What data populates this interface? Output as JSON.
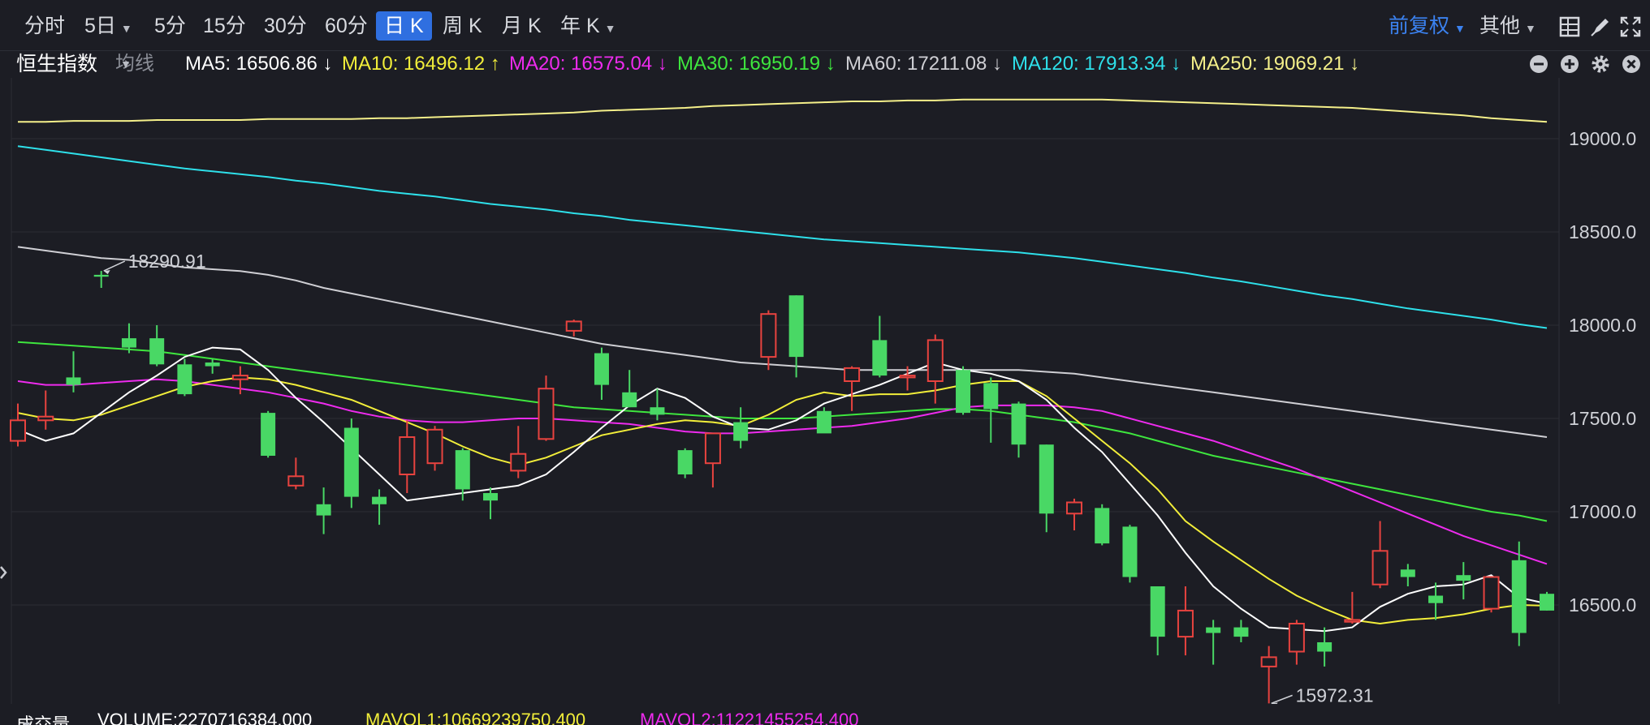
{
  "toolbar": {
    "timeframes": [
      {
        "label": "分时",
        "active": false,
        "dropdown": false
      },
      {
        "label": "5日",
        "active": false,
        "dropdown": true
      },
      {
        "label": "5分",
        "active": false,
        "dropdown": false
      },
      {
        "label": "15分",
        "active": false,
        "dropdown": false
      },
      {
        "label": "30分",
        "active": false,
        "dropdown": false
      },
      {
        "label": "60分",
        "active": false,
        "dropdown": false
      },
      {
        "label": "日 K",
        "active": true,
        "dropdown": false
      },
      {
        "label": "周 K",
        "active": false,
        "dropdown": false
      },
      {
        "label": "月 K",
        "active": false,
        "dropdown": false
      },
      {
        "label": "年 K",
        "active": false,
        "dropdown": true
      }
    ],
    "adjust_label": "前复权",
    "other_label": "其他",
    "icons": [
      "grid-layout-icon",
      "pen-draw-icon",
      "fullscreen-icon"
    ]
  },
  "indicator_bar": {
    "index_name": "恒生指数",
    "ma_selector": "均线",
    "mas": [
      {
        "label": "MA5: 16506.86",
        "arrow": "↓",
        "color": "#ffffff"
      },
      {
        "label": "MA10: 16496.12",
        "arrow": "↑",
        "color": "#f2ee3a"
      },
      {
        "label": "MA20: 16575.04",
        "arrow": "↓",
        "color": "#ee2bee"
      },
      {
        "label": "MA30: 16950.19",
        "arrow": "↓",
        "color": "#3ee63e"
      },
      {
        "label": "MA60: 17211.08",
        "arrow": "↓",
        "color": "#cfcfd4"
      },
      {
        "label": "MA120: 17913.34",
        "arrow": "↓",
        "color": "#2ee0ea"
      },
      {
        "label": "MA250: 19069.21",
        "arrow": "↓",
        "color": "#f5f08a"
      }
    ],
    "controls": [
      "minus-circle-icon",
      "plus-circle-icon",
      "gear-icon",
      "close-icon"
    ]
  },
  "chart_data": {
    "type": "candlestick",
    "ylim": [
      15980,
      19250
    ],
    "y_ticks": [
      19000.0,
      18500.0,
      18000.0,
      17500.0,
      17000.0,
      16500.0
    ],
    "y_tick_labels": [
      "19000.0",
      "18500.0",
      "18000.0",
      "17500.0",
      "17000.0",
      "16500.0"
    ],
    "up_color": "#e8433f",
    "down_color": "#49d865",
    "candles": [
      {
        "open": 17380,
        "high": 17580,
        "low": 17350,
        "close": 17490
      },
      {
        "open": 17490,
        "high": 17650,
        "low": 17440,
        "close": 17510
      },
      {
        "open": 17720,
        "high": 17860,
        "low": 17640,
        "close": 17680
      },
      {
        "open": 18270,
        "high": 18290.91,
        "low": 18200,
        "close": 18260
      },
      {
        "open": 17930,
        "high": 18010,
        "low": 17850,
        "close": 17880
      },
      {
        "open": 17930,
        "high": 18000,
        "low": 17780,
        "close": 17790
      },
      {
        "open": 17790,
        "high": 17820,
        "low": 17620,
        "close": 17630
      },
      {
        "open": 17800,
        "high": 17820,
        "low": 17740,
        "close": 17780
      },
      {
        "open": 17710,
        "high": 17780,
        "low": 17630,
        "close": 17730
      },
      {
        "open": 17530,
        "high": 17540,
        "low": 17290,
        "close": 17300
      },
      {
        "open": 17140,
        "high": 17290,
        "low": 17120,
        "close": 17190
      },
      {
        "open": 17040,
        "high": 17130,
        "low": 16880,
        "close": 16980
      },
      {
        "open": 17450,
        "high": 17500,
        "low": 17020,
        "close": 17080
      },
      {
        "open": 17080,
        "high": 17120,
        "low": 16930,
        "close": 17040
      },
      {
        "open": 17200,
        "high": 17490,
        "low": 17100,
        "close": 17400
      },
      {
        "open": 17260,
        "high": 17460,
        "low": 17220,
        "close": 17440
      },
      {
        "open": 17330,
        "high": 17340,
        "low": 17060,
        "close": 17120
      },
      {
        "open": 17100,
        "high": 17130,
        "low": 16960,
        "close": 17060
      },
      {
        "open": 17220,
        "high": 17460,
        "low": 17180,
        "close": 17310
      },
      {
        "open": 17390,
        "high": 17730,
        "low": 17380,
        "close": 17660
      },
      {
        "open": 17970,
        "high": 18030,
        "low": 17940,
        "close": 18020
      },
      {
        "open": 17850,
        "high": 17880,
        "low": 17600,
        "close": 17680
      },
      {
        "open": 17640,
        "high": 17760,
        "low": 17560,
        "close": 17560
      },
      {
        "open": 17560,
        "high": 17660,
        "low": 17490,
        "close": 17520
      },
      {
        "open": 17330,
        "high": 17340,
        "low": 17180,
        "close": 17200
      },
      {
        "open": 17260,
        "high": 17410,
        "low": 17130,
        "close": 17420
      },
      {
        "open": 17480,
        "high": 17560,
        "low": 17340,
        "close": 17380
      },
      {
        "open": 17830,
        "high": 18080,
        "low": 17760,
        "close": 18060
      },
      {
        "open": 18160,
        "high": 18160,
        "low": 17720,
        "close": 17830
      },
      {
        "open": 17540,
        "high": 17560,
        "low": 17430,
        "close": 17420
      },
      {
        "open": 17700,
        "high": 17780,
        "low": 17540,
        "close": 17770
      },
      {
        "open": 17920,
        "high": 18050,
        "low": 17720,
        "close": 17730
      },
      {
        "open": 17720,
        "high": 17780,
        "low": 17650,
        "close": 17730
      },
      {
        "open": 17700,
        "high": 17950,
        "low": 17580,
        "close": 17920
      },
      {
        "open": 17760,
        "high": 17780,
        "low": 17520,
        "close": 17530
      },
      {
        "open": 17690,
        "high": 17720,
        "low": 17370,
        "close": 17550
      },
      {
        "open": 17580,
        "high": 17590,
        "low": 17290,
        "close": 17360
      },
      {
        "open": 17360,
        "high": 17360,
        "low": 16890,
        "close": 16990
      },
      {
        "open": 16990,
        "high": 17070,
        "low": 16900,
        "close": 17050
      },
      {
        "open": 17020,
        "high": 17040,
        "low": 16820,
        "close": 16830
      },
      {
        "open": 16920,
        "high": 16930,
        "low": 16620,
        "close": 16650
      },
      {
        "open": 16600,
        "high": 16600,
        "low": 16230,
        "close": 16330
      },
      {
        "open": 16330,
        "high": 16600,
        "low": 16230,
        "close": 16470
      },
      {
        "open": 16380,
        "high": 16420,
        "low": 16180,
        "close": 16350
      },
      {
        "open": 16380,
        "high": 16420,
        "low": 16300,
        "close": 16330
      },
      {
        "open": 16170,
        "high": 16280,
        "low": 15972.31,
        "close": 16220
      },
      {
        "open": 16250,
        "high": 16420,
        "low": 16180,
        "close": 16400
      },
      {
        "open": 16300,
        "high": 16380,
        "low": 16170,
        "close": 16250
      },
      {
        "open": 16410,
        "high": 16570,
        "low": 16400,
        "close": 16420
      },
      {
        "open": 16610,
        "high": 16950,
        "low": 16590,
        "close": 16790
      },
      {
        "open": 16690,
        "high": 16720,
        "low": 16600,
        "close": 16650
      },
      {
        "open": 16550,
        "high": 16620,
        "low": 16420,
        "close": 16510
      },
      {
        "open": 16660,
        "high": 16730,
        "low": 16530,
        "close": 16630
      },
      {
        "open": 16480,
        "high": 16650,
        "low": 16460,
        "close": 16650
      },
      {
        "open": 16740,
        "high": 16840,
        "low": 16280,
        "close": 16350
      },
      {
        "open": 16560,
        "high": 16570,
        "low": 16470,
        "close": 16470
      }
    ],
    "ma_lines": [
      {
        "name": "MA250",
        "color": "#f5f08a",
        "values": [
          19090,
          19090,
          19095,
          19095,
          19095,
          19100,
          19100,
          19100,
          19100,
          19105,
          19105,
          19105,
          19105,
          19110,
          19110,
          19115,
          19120,
          19125,
          19130,
          19135,
          19140,
          19150,
          19155,
          19160,
          19165,
          19175,
          19180,
          19185,
          19190,
          19195,
          19200,
          19200,
          19205,
          19205,
          19210,
          19210,
          19210,
          19210,
          19210,
          19210,
          19205,
          19200,
          19195,
          19190,
          19185,
          19180,
          19175,
          19170,
          19165,
          19155,
          19145,
          19135,
          19125,
          19110,
          19100,
          19090
        ]
      },
      {
        "name": "MA120",
        "color": "#2ee0ea",
        "values": [
          18960,
          18940,
          18920,
          18900,
          18880,
          18860,
          18840,
          18825,
          18810,
          18795,
          18775,
          18760,
          18740,
          18720,
          18705,
          18690,
          18670,
          18650,
          18635,
          18620,
          18600,
          18585,
          18565,
          18550,
          18535,
          18520,
          18505,
          18490,
          18475,
          18460,
          18450,
          18440,
          18430,
          18420,
          18410,
          18400,
          18390,
          18375,
          18360,
          18340,
          18320,
          18300,
          18280,
          18255,
          18235,
          18210,
          18185,
          18160,
          18140,
          18115,
          18090,
          18070,
          18050,
          18030,
          18005,
          17985
        ]
      },
      {
        "name": "MA60",
        "color": "#cfcfd4",
        "values": [
          18420,
          18400,
          18380,
          18360,
          18350,
          18330,
          18310,
          18300,
          18290,
          18270,
          18240,
          18200,
          18170,
          18140,
          18110,
          18080,
          18050,
          18020,
          17990,
          17960,
          17930,
          17900,
          17880,
          17860,
          17840,
          17820,
          17800,
          17790,
          17780,
          17770,
          17760,
          17760,
          17760,
          17760,
          17760,
          17760,
          17760,
          17750,
          17740,
          17720,
          17700,
          17680,
          17660,
          17640,
          17620,
          17600,
          17580,
          17560,
          17540,
          17520,
          17500,
          17480,
          17460,
          17440,
          17420,
          17400
        ]
      },
      {
        "name": "MA30",
        "color": "#3ee63e",
        "values": [
          17910,
          17900,
          17890,
          17880,
          17870,
          17860,
          17840,
          17820,
          17800,
          17780,
          17760,
          17740,
          17720,
          17700,
          17680,
          17660,
          17640,
          17620,
          17600,
          17580,
          17560,
          17550,
          17540,
          17530,
          17520,
          17510,
          17500,
          17500,
          17500,
          17510,
          17520,
          17530,
          17540,
          17550,
          17550,
          17540,
          17520,
          17500,
          17480,
          17450,
          17420,
          17380,
          17340,
          17300,
          17270,
          17240,
          17210,
          17180,
          17150,
          17120,
          17090,
          17060,
          17030,
          17000,
          16980,
          16950
        ]
      },
      {
        "name": "MA20",
        "color": "#ee2bee",
        "values": [
          17700,
          17680,
          17680,
          17690,
          17700,
          17710,
          17700,
          17680,
          17660,
          17640,
          17610,
          17580,
          17540,
          17510,
          17490,
          17480,
          17480,
          17490,
          17500,
          17500,
          17490,
          17480,
          17470,
          17450,
          17430,
          17420,
          17420,
          17430,
          17440,
          17450,
          17460,
          17480,
          17500,
          17530,
          17560,
          17570,
          17570,
          17570,
          17560,
          17540,
          17500,
          17460,
          17420,
          17380,
          17330,
          17280,
          17230,
          17170,
          17110,
          17050,
          16990,
          16930,
          16870,
          16820,
          16770,
          16720
        ]
      },
      {
        "name": "MA10",
        "color": "#f2ee3a",
        "values": [
          17530,
          17500,
          17490,
          17520,
          17570,
          17620,
          17670,
          17700,
          17720,
          17710,
          17680,
          17640,
          17600,
          17540,
          17480,
          17420,
          17350,
          17290,
          17250,
          17290,
          17350,
          17410,
          17440,
          17470,
          17490,
          17480,
          17460,
          17520,
          17600,
          17640,
          17620,
          17630,
          17630,
          17650,
          17680,
          17700,
          17700,
          17620,
          17500,
          17380,
          17260,
          17120,
          16950,
          16840,
          16740,
          16640,
          16550,
          16480,
          16420,
          16400,
          16420,
          16430,
          16450,
          16480,
          16500,
          16496
        ]
      },
      {
        "name": "MA5",
        "color": "#ffffff",
        "values": [
          17440,
          17380,
          17420,
          17530,
          17640,
          17730,
          17830,
          17880,
          17870,
          17760,
          17610,
          17480,
          17340,
          17200,
          17060,
          17080,
          17100,
          17120,
          17140,
          17200,
          17320,
          17450,
          17570,
          17660,
          17610,
          17510,
          17450,
          17440,
          17490,
          17580,
          17630,
          17680,
          17740,
          17800,
          17760,
          17740,
          17700,
          17600,
          17450,
          17320,
          17150,
          16980,
          16780,
          16600,
          16480,
          16380,
          16370,
          16360,
          16380,
          16490,
          16560,
          16600,
          16610,
          16660,
          16540,
          16507
        ]
      }
    ],
    "annotations": [
      {
        "label": "18290.91",
        "kind": "high"
      },
      {
        "label": "15972.31",
        "kind": "low"
      }
    ]
  },
  "volume_bar": {
    "title": "成交量",
    "volume": "VOLUME:2270716384.000",
    "mavol1": "MAVOL1:10669239750.400",
    "mavol2": "MAVOL2:11221455254.400"
  }
}
